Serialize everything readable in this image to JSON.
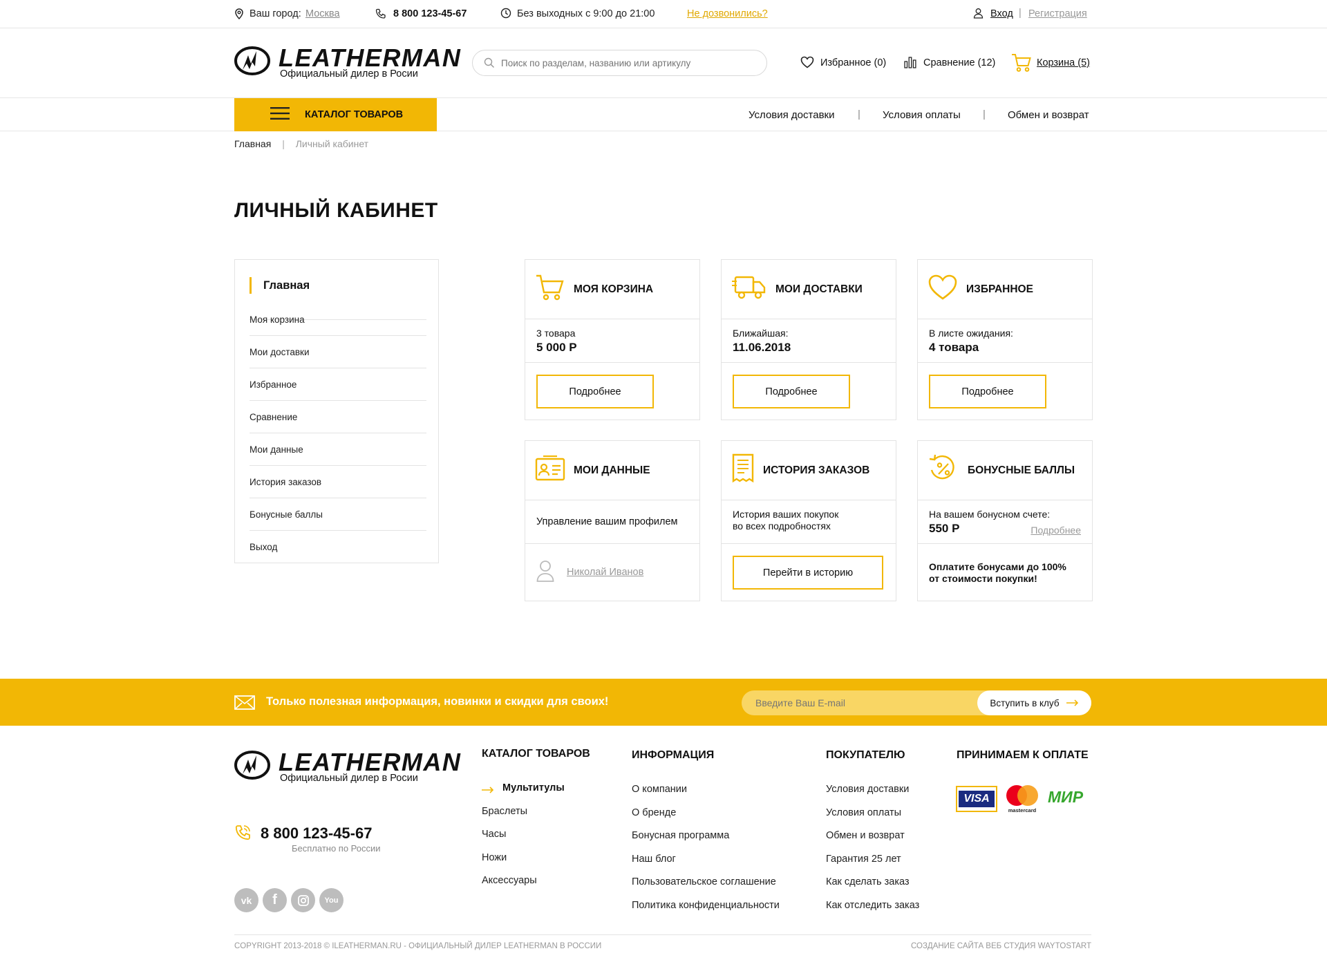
{
  "topbar": {
    "city_label": "Ваш город:",
    "city": "Москва",
    "phone": "8 800 123-45-67",
    "hours": "Без выходных с 9:00 до 21:00",
    "callback": "Не дозвонились?",
    "login": "Вход",
    "register": "Регистрация"
  },
  "header": {
    "logo_text": "LEATHERMAN",
    "logo_sub": "Официальный дилер в Росии",
    "search_placeholder": "Поиск по разделам, названию или артикулу",
    "favorites": "Избранное (0)",
    "compare": "Сравнение (12)",
    "cart": "Корзина (5)"
  },
  "nav": {
    "catalog": "Каталог товаров",
    "links": [
      "Условия доставки",
      "Условия оплаты",
      "Обмен и возврат"
    ],
    "sep": "|"
  },
  "breadcrumbs": {
    "home": "Главная",
    "sep": "|",
    "current": "Личный кабинет"
  },
  "page_title": "ЛИЧНЫЙ КАБИНЕТ",
  "sidebar": {
    "active": "Главная",
    "items": [
      "Моя корзина",
      "Мои доставки",
      "Избранное",
      "Сравнение",
      "Мои данные",
      "История заказов",
      "Бонусные баллы",
      "Выход"
    ]
  },
  "cards": {
    "cart": {
      "title": "Моя корзина",
      "line1": "3 товара",
      "line2": "5 000 Р",
      "button": "Подробнее"
    },
    "deliveries": {
      "title": "Мои доставки",
      "line1": "Ближайшая:",
      "line2": "11.06.2018",
      "button": "Подробнее"
    },
    "favorites": {
      "title": "Избранное",
      "line1": "В листе ожидания:",
      "line2": "4 товара",
      "button": "Подробнее"
    },
    "profile": {
      "title": "Мои данные",
      "text": "Управление вашим профилем",
      "user": "Николай Иванов"
    },
    "history": {
      "title": "История заказов",
      "text1": "История ваших покупок",
      "text2": "во всех подробностях",
      "button": "Перейти в историю"
    },
    "bonus": {
      "title": "Бонусные баллы",
      "line1": "На вашем бонусном счете:",
      "line2": "550 Р",
      "link": "Подробнее",
      "note1": "Оплатите бонусами до 100%",
      "note2": "от стоимости покупки!"
    }
  },
  "promo": {
    "text": "Только полезная информация, новинки и скидки для своих!",
    "email_placeholder": "Введите Ваш E-mail",
    "button": "Вступить в клуб"
  },
  "footer": {
    "phone": "8 800 123-45-67",
    "phone_note": "Бесплатно по России",
    "socials": [
      "vk",
      "f",
      "ig",
      "yt"
    ],
    "catalog_title": "Каталог товаров",
    "catalog_items": [
      "Мультитулы",
      "Браслеты",
      "Часы",
      "Ножи",
      "Аксессуары"
    ],
    "info_title": "Информация",
    "info_items": [
      "О компании",
      "О бренде",
      "Бонусная программа",
      "Наш блог",
      "Пользовательское соглашение",
      "Политика конфиденциальности"
    ],
    "buyer_title": "Покупателю",
    "buyer_items": [
      "Условия доставки",
      "Условия оплаты",
      "Обмен и возврат",
      "Гарантия 25 лет",
      "Как сделать заказ",
      "Как отследить заказ"
    ],
    "pay_title": "Принимаем к оплате",
    "pay_visa": "VISA",
    "pay_mc": "mastercard",
    "pay_mir": "МИР",
    "copyright": "Copyright 2013-2018 © ileatherman.ru - официальный дилер leatherman в России",
    "credit": "Создание сайта веб студия waytostart"
  },
  "colors": {
    "accent": "#f2b705",
    "text": "#111111",
    "muted": "#999999"
  }
}
